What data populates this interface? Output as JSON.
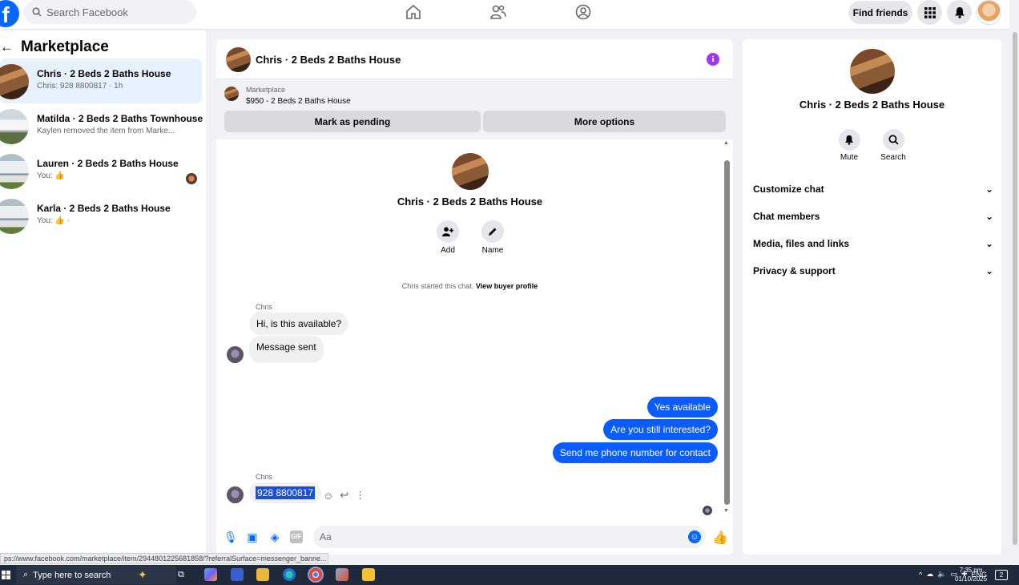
{
  "topbar": {
    "logo": "f",
    "search_placeholder": "Search Facebook",
    "find_friends": "Find friends",
    "icons": [
      "home-icon",
      "friends-icon",
      "groups-icon",
      "menu-grid-icon",
      "bell-icon"
    ]
  },
  "sidebar": {
    "title": "Marketplace",
    "conversations": [
      {
        "title": "Chris · 2 Beds 2 Baths House",
        "subtitle": "Chris: 928 8800817 · 1h",
        "active": true
      },
      {
        "title": "Matilda · 2 Beds 2 Baths Townhouse",
        "subtitle": "Kaylen removed the item from Marke...",
        "active": false
      },
      {
        "title": "Lauren · 2 Beds 2 Baths House",
        "subtitle": "You: 👍",
        "active": false
      },
      {
        "title": "Karla · 2 Beds 2 Baths House",
        "subtitle": "You: 👍 ·",
        "active": false
      }
    ]
  },
  "chat": {
    "header_title": "Chris · 2 Beds 2 Baths House",
    "listing_label": "Marketplace",
    "listing_price": "$950 - 2 Beds 2 Baths House",
    "mark_pending": "Mark as pending",
    "more_options": "More options",
    "intro_title": "Chris · 2 Beds 2 Baths House",
    "add_label": "Add",
    "name_label": "Name",
    "started_text": "Chris started this chat.",
    "view_buyer": "View buyer profile",
    "sender_name": "Chris",
    "incoming_1": "Hi, is this available?",
    "incoming_2": "Message sent",
    "outgoing": [
      "Yes available",
      "Are you still interested?",
      "Send me phone number for contact"
    ],
    "sender_name_2": "Chris",
    "phone_message": "928 8800817",
    "composer_placeholder": "Aa"
  },
  "details": {
    "title": "Chris · 2 Beds 2 Baths House",
    "mute": "Mute",
    "search": "Search",
    "sections": [
      "Customize chat",
      "Chat members",
      "Media, files and links",
      "Privacy & support"
    ]
  },
  "status_url": "ps://www.facebook.com/marketplace/item/2944801225681858/?referralSurface=messenger_banne...",
  "taskbar": {
    "search_placeholder": "Type here to search",
    "language": "ENG",
    "time": "7:35 pm",
    "date": "01/10/2025",
    "notifications": "2"
  },
  "colors": {
    "accent": "#0866ff",
    "outgoing_bubble": "#0a5cff",
    "info": "#a033ff"
  }
}
